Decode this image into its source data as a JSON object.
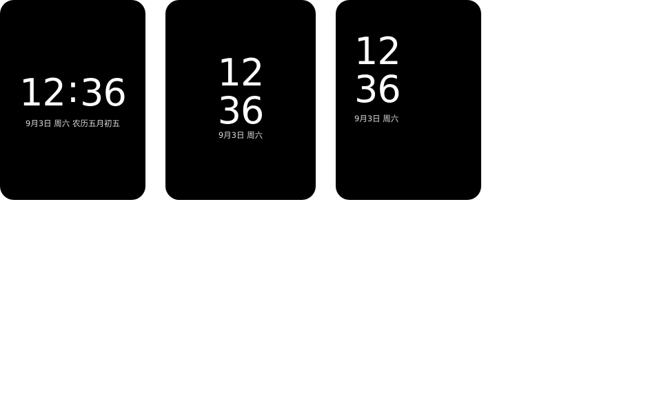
{
  "faces": [
    {
      "hour": "12",
      "separator": ":",
      "minute": "36",
      "date": "9月3日 周六 农历五月初五"
    },
    {
      "hour": "12",
      "minute": "36",
      "date": "9月3日 周六"
    },
    {
      "hour": "12",
      "minute": "36",
      "date": "9月3日 周六"
    }
  ]
}
